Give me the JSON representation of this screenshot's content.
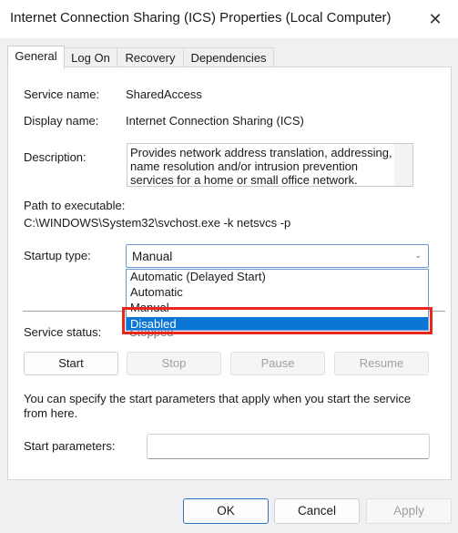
{
  "window": {
    "title": "Internet Connection Sharing (ICS) Properties (Local Computer)",
    "close_glyph": "✕"
  },
  "tabs": [
    {
      "label": "General"
    },
    {
      "label": "Log On"
    },
    {
      "label": "Recovery"
    },
    {
      "label": "Dependencies"
    }
  ],
  "general": {
    "service_name_label": "Service name:",
    "service_name_value": "SharedAccess",
    "display_name_label": "Display name:",
    "display_name_value": "Internet Connection Sharing (ICS)",
    "description_label": "Description:",
    "description_value": "Provides network address translation, addressing, name resolution and/or intrusion prevention services for a home or small office network.",
    "path_label": "Path to executable:",
    "path_value": "C:\\WINDOWS\\System32\\svchost.exe -k netsvcs -p",
    "startup_type_label": "Startup type:",
    "startup_type_value": "Manual",
    "startup_options": [
      "Automatic (Delayed Start)",
      "Automatic",
      "Manual",
      "Disabled"
    ],
    "service_status_label": "Service status:",
    "service_status_value": "Stopped",
    "buttons": {
      "start": "Start",
      "stop": "Stop",
      "pause": "Pause",
      "resume": "Resume"
    },
    "params_help": "You can specify the start parameters that apply when you start the service from here.",
    "start_params_label": "Start parameters:",
    "start_params_value": ""
  },
  "footer": {
    "ok": "OK",
    "cancel": "Cancel",
    "apply": "Apply"
  },
  "colors": {
    "selection": "#0b76d6",
    "highlight": "#e8261b"
  }
}
